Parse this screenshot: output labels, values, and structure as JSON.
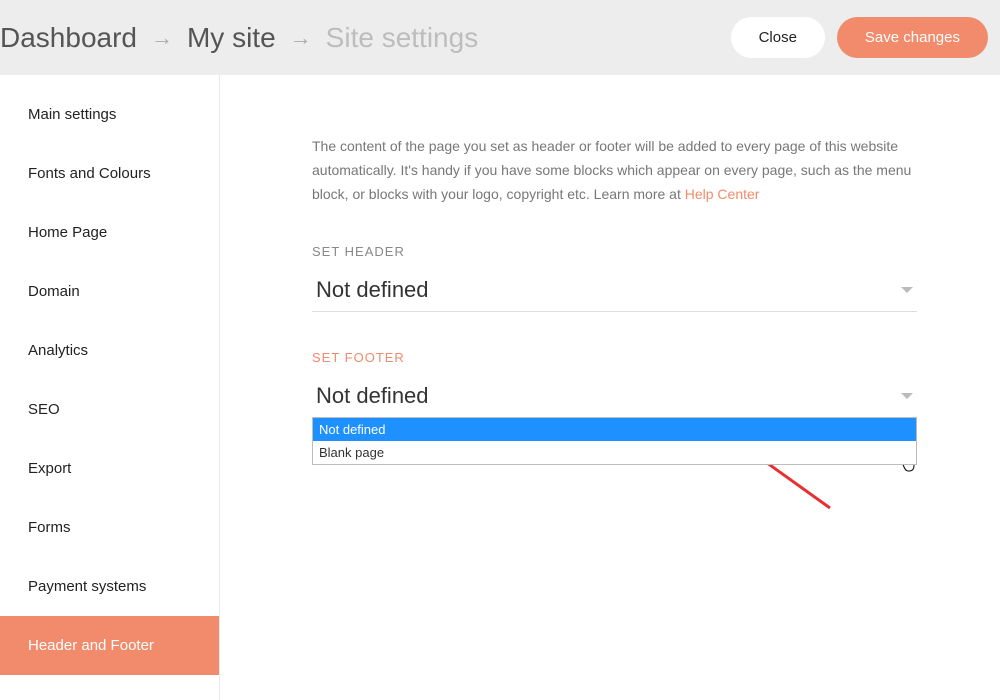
{
  "breadcrumbs": {
    "items": [
      {
        "label": "Dashboard"
      },
      {
        "label": "My site"
      },
      {
        "label": "Site settings"
      }
    ],
    "arrow": "→"
  },
  "buttons": {
    "close": "Close",
    "save": "Save changes"
  },
  "sidebar": {
    "items": [
      {
        "label": "Main settings"
      },
      {
        "label": "Fonts and Colours"
      },
      {
        "label": "Home Page"
      },
      {
        "label": "Domain"
      },
      {
        "label": "Analytics"
      },
      {
        "label": "SEO"
      },
      {
        "label": "Export"
      },
      {
        "label": "Forms"
      },
      {
        "label": "Payment systems"
      },
      {
        "label": "Header and Footer"
      }
    ],
    "active_index": 9
  },
  "content": {
    "intro": "The content of the page you set as header or footer will be added to every page of this website automatically. It's handy if you have some blocks which appear on every page, such as the menu block, or blocks with your logo, copyright etc. Learn more at ",
    "help_link": "Help Center",
    "header_field": {
      "label": "SET HEADER",
      "value": "Not defined"
    },
    "footer_field": {
      "label": "SET FOOTER",
      "value": "Not defined",
      "options": [
        "Not defined",
        "Blank page"
      ],
      "highlighted_index": 0
    }
  }
}
